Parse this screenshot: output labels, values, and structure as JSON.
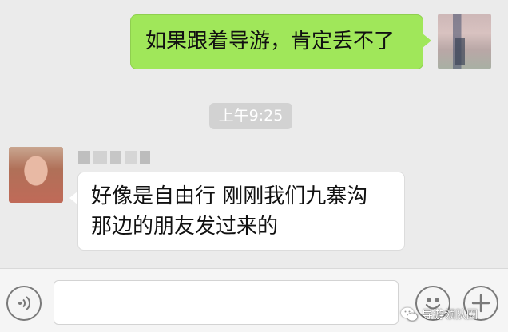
{
  "messages": [
    {
      "direction": "outgoing",
      "text": "如果跟着导游，肯定丢不了"
    },
    {
      "direction": "incoming",
      "lines": [
        "好像是自由行 刚刚我们九寨沟",
        "那边的朋友发过来的"
      ]
    }
  ],
  "timestamp": "上午9:25",
  "input_bar": {
    "icons": [
      "voice-icon",
      "emoji-icon",
      "plus-icon"
    ]
  },
  "watermark": {
    "text": "导游领队圈",
    "icon": "wechat-official-account-icon"
  },
  "colors": {
    "background": "#ebebeb",
    "outgoing_bubble": "#a0e75a",
    "incoming_bubble": "#ffffff",
    "timestamp_bg": "#d2d2d2"
  }
}
